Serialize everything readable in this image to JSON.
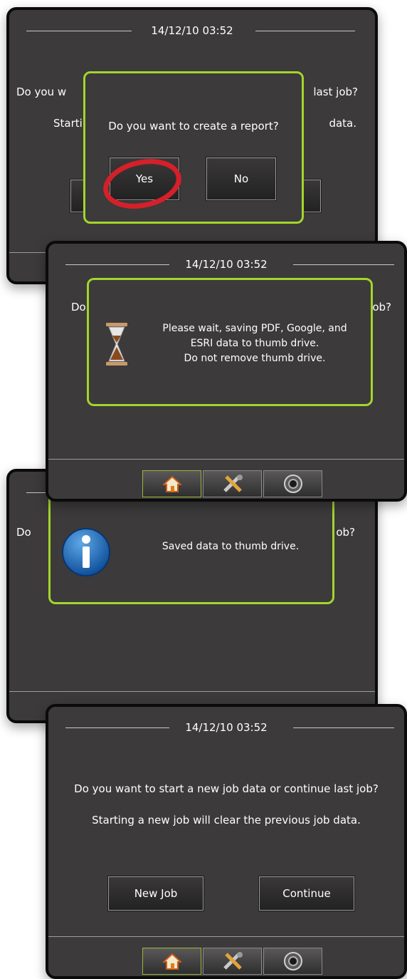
{
  "timestamp": "14/12/10 03:52",
  "screen1": {
    "bg_question_left": "Do you w",
    "bg_question_right": "last job?",
    "bg_info_left": "Starti",
    "bg_info_right": "data.",
    "dialog_question": "Do you want to create a report?",
    "yes_label": "Yes",
    "no_label": "No"
  },
  "screen2": {
    "bg_question_left": "Do",
    "bg_question_right": "ob?",
    "saving_line1": "Please wait, saving PDF, Google, and",
    "saving_line2": "ESRI data to thumb drive.",
    "saving_line3": "Do not remove thumb drive."
  },
  "screen3": {
    "bg_question_left": "Do",
    "bg_question_right": "ob?",
    "saved_message": "Saved data to thumb drive."
  },
  "screen4": {
    "question": "Do you want to start a new job data or continue last job?",
    "info": "Starting a new job will clear the previous job data.",
    "new_job_label": "New Job",
    "continue_label": "Continue"
  },
  "nav": {
    "icons": [
      "home-icon",
      "tools-icon",
      "camera-icon"
    ],
    "active": "home"
  },
  "colors": {
    "accent": "#a3d52c",
    "highlight_circle": "#d4202a",
    "screen_bg": "#3c3a3b"
  }
}
